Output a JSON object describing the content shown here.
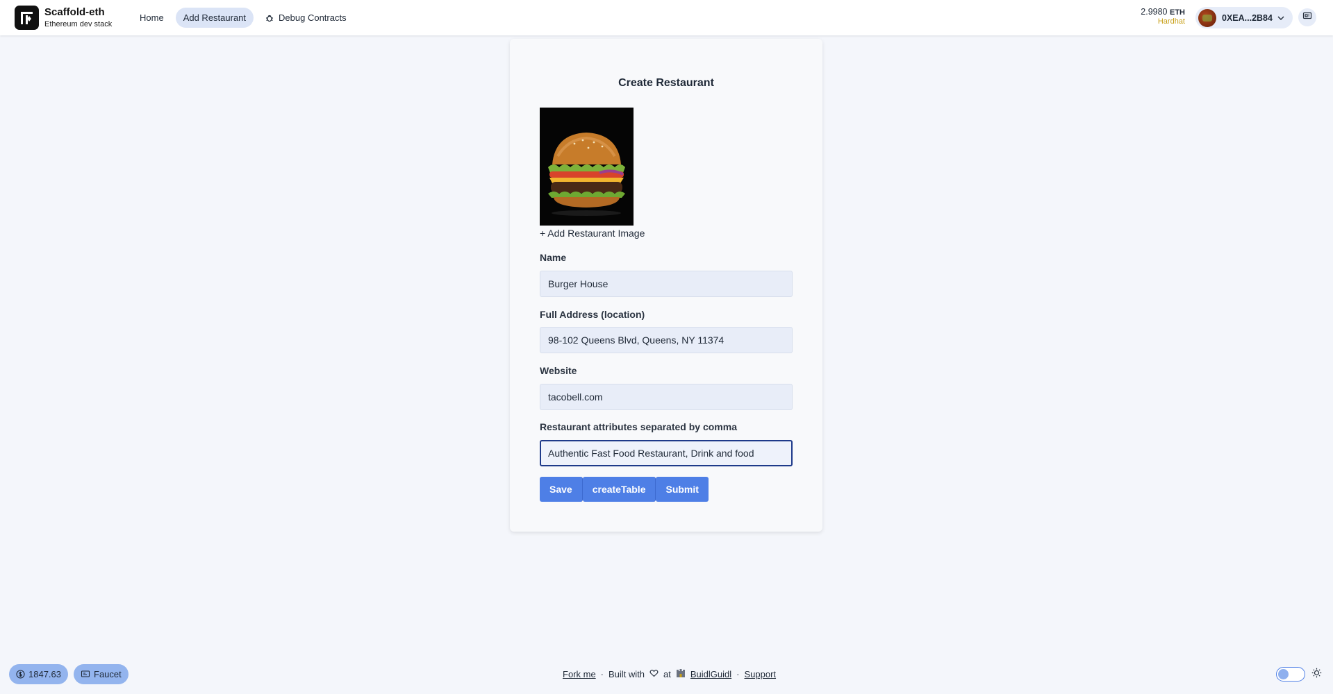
{
  "brand": {
    "title": "Scaffold-eth",
    "subtitle": "Ethereum dev stack"
  },
  "nav": {
    "home": "Home",
    "add_restaurant": "Add Restaurant",
    "debug_contracts": "Debug Contracts"
  },
  "wallet": {
    "balance": "2.9980",
    "unit": "ETH",
    "network": "Hardhat",
    "address": "0XEA...2B84"
  },
  "form": {
    "title": "Create Restaurant",
    "add_image_label": "+ Add Restaurant Image",
    "name_label": "Name",
    "name_value": "Burger House",
    "address_label": "Full Address (location)",
    "address_value": "98-102 Queens Blvd, Queens, NY 11374",
    "website_label": "Website",
    "website_value": "tacobell.com",
    "attributes_label": "Restaurant attributes separated by comma",
    "attributes_value": "Authentic Fast Food Restaurant, Drink and food",
    "save_label": "Save",
    "create_table_label": "createTable",
    "submit_label": "Submit"
  },
  "footer": {
    "price": "1847.63",
    "faucet": "Faucet",
    "fork_me": "Fork me",
    "built_with": "Built with",
    "at": "at",
    "buidlguidl": "BuidlGuidl",
    "support": "Support",
    "sep": "·"
  },
  "colors": {
    "accent": "#4e7fe6",
    "network": "#c8a019",
    "active_nav": "#dbe4f6"
  }
}
